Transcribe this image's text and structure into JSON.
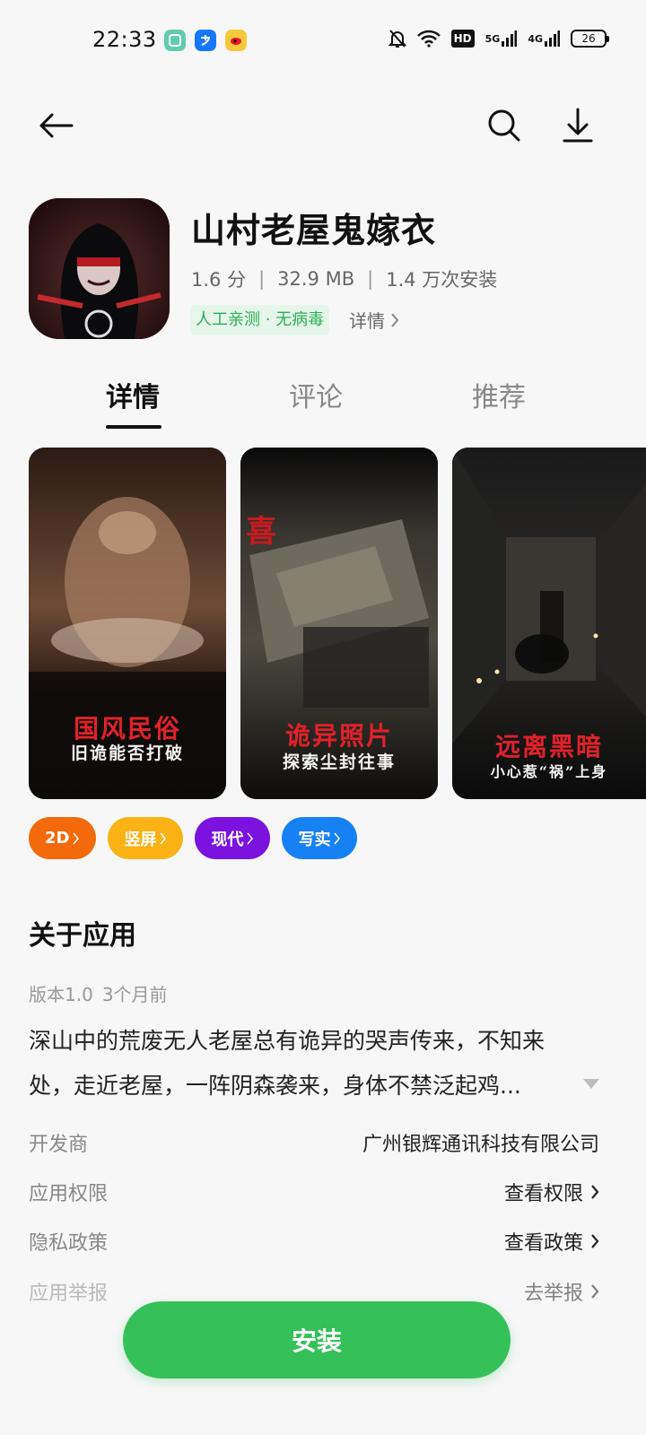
{
  "status_bar": {
    "time": "22:33",
    "hd_label": "HD",
    "signal_1": "5G",
    "signal_2": "4G",
    "battery": "26"
  },
  "app": {
    "title": "山村老屋鬼嫁衣",
    "rating": "1.6 分",
    "size": "32.9 MB",
    "installs": "1.4 万次安装",
    "separator": "|",
    "safety_badge": "人工亲测 · 无病毒",
    "details_link": "详情"
  },
  "tabs": [
    {
      "label": "详情"
    },
    {
      "label": "评论"
    },
    {
      "label": "推荐"
    }
  ],
  "screenshots": [
    {
      "title": "国风民俗",
      "subtitle": "旧诡能否打破"
    },
    {
      "title": "诡异照片",
      "subtitle": "探索尘封往事"
    },
    {
      "title": "远离黑暗",
      "subtitle": "小心惹“祸”上身"
    }
  ],
  "tags": [
    {
      "label": "2D",
      "color": "#f26a0b"
    },
    {
      "label": "竖屏",
      "color": "#fbb215"
    },
    {
      "label": "现代",
      "color": "#7b12e0"
    },
    {
      "label": "写实",
      "color": "#1681f3"
    }
  ],
  "about": {
    "heading": "关于应用",
    "version": "版本1.0",
    "updated": "3个月前",
    "description_line1": "深山中的荒废无人老屋总有诡异的哭声传来，不知来",
    "description_line2": "处，走近老屋，一阵阴森袭来，身体不禁泛起鸡..."
  },
  "info_rows": [
    {
      "label": "开发商",
      "value": "广州银辉通讯科技有限公司"
    },
    {
      "label": "应用权限",
      "value": "查看权限"
    },
    {
      "label": "隐私政策",
      "value": "查看政策"
    },
    {
      "label": "应用举报",
      "value": "去举报"
    }
  ],
  "install_button": "安装",
  "colors": {
    "install_green": "#35c159",
    "safety_green": "#2fae55",
    "caption_red": "#e0222a"
  }
}
